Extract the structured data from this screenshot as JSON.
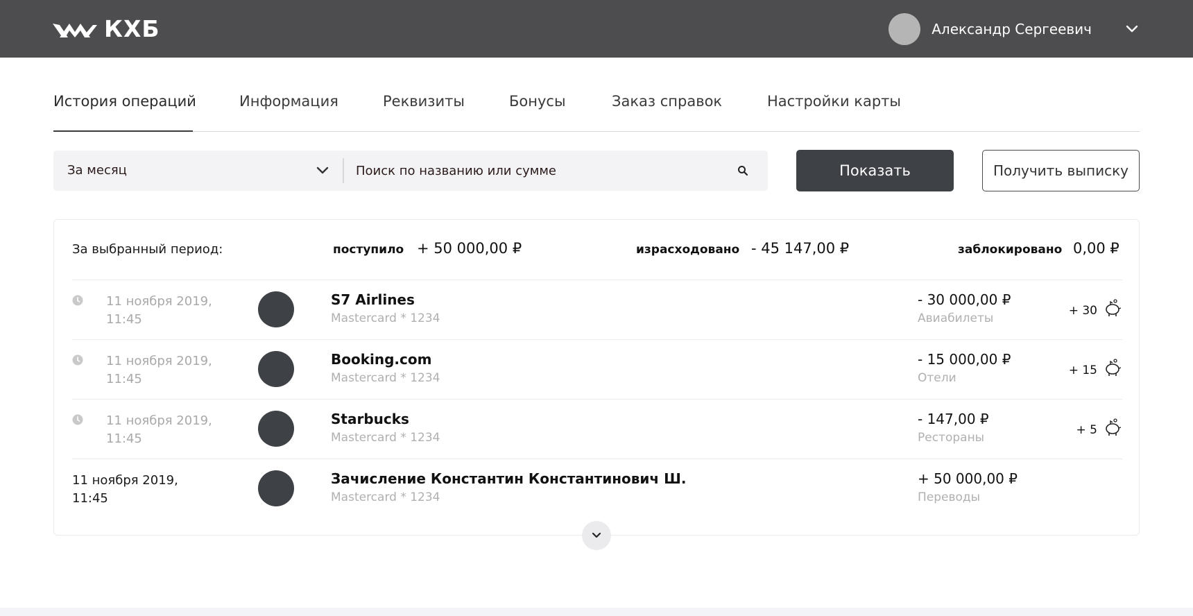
{
  "header": {
    "logo_text": "КХБ",
    "user_name": "Александр Сергеевич",
    "icons": {
      "logo": "bird-logo-icon",
      "menu": "chevron-down-icon"
    }
  },
  "tabs": [
    {
      "label": "История операций",
      "active": true
    },
    {
      "label": "Информация",
      "active": false
    },
    {
      "label": "Реквизиты",
      "active": false
    },
    {
      "label": "Бонусы",
      "active": false
    },
    {
      "label": "Заказ справок",
      "active": false
    },
    {
      "label": "Настройки карты",
      "active": false
    }
  ],
  "filter": {
    "period": "За месяц",
    "search_placeholder": "Поиск по названию или сумме",
    "search_value": ""
  },
  "buttons": {
    "show": "Показать",
    "statement": "Получить выписку"
  },
  "summary": {
    "label": "За выбранный период:",
    "received_label": "поступило",
    "received_value": "+ 50 000,00 ₽",
    "spent_label": "израсходовано",
    "spent_value": "- 45 147,00 ₽",
    "blocked_label": "заблокировано",
    "blocked_value": "0,00 ₽"
  },
  "transactions": [
    {
      "date": "11 ноября 2019,\n11:45",
      "pending": true,
      "title": "S7 Airlines",
      "card": "Mastercard * 1234",
      "amount": "- 30 000,00 ₽",
      "category": "Авиабилеты",
      "bonus": "+ 30"
    },
    {
      "date": "11 ноября 2019,\n11:45",
      "pending": true,
      "title": "Booking.com",
      "card": "Mastercard * 1234",
      "amount": "- 15 000,00 ₽",
      "category": "Отели",
      "bonus": "+ 15"
    },
    {
      "date": "11 ноября 2019,\n11:45",
      "pending": true,
      "title": "Starbucks",
      "card": "Mastercard * 1234",
      "amount": "- 147,00 ₽",
      "category": "Рестораны",
      "bonus": "+ 5"
    },
    {
      "date": "11 ноября 2019,\n11:45",
      "pending": false,
      "title": "Зачисление Константин Константинович Ш.",
      "card": "Mastercard * 1234",
      "amount": "+ 50 000,00 ₽",
      "category": "Переводы",
      "bonus": ""
    }
  ],
  "colors": {
    "header_bg": "#4d4d4f",
    "primary_button": "#3e4146",
    "muted_text": "#b0b0b0"
  }
}
